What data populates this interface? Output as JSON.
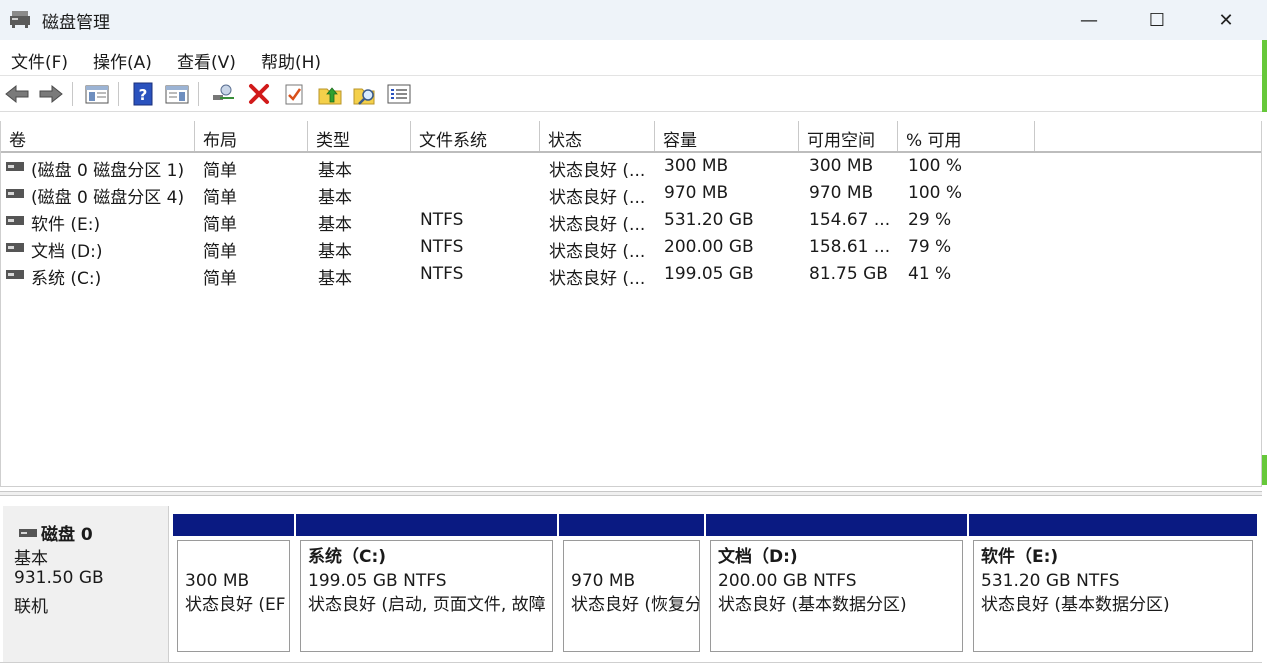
{
  "window": {
    "title": "磁盘管理",
    "minimize_glyph": "—",
    "maximize_glyph": "☐",
    "close_glyph": "✕"
  },
  "menu": [
    {
      "label": "文件(F)"
    },
    {
      "label": "操作(A)"
    },
    {
      "label": "查看(V)"
    },
    {
      "label": "帮助(H)"
    }
  ],
  "toolbar_icons": [
    "back-arrow-icon",
    "forward-arrow-icon",
    "console-tree-icon",
    "help-icon",
    "action-pane-icon",
    "connect-disk-icon",
    "delete-icon",
    "properties-check-icon",
    "up-folder-icon",
    "search-folder-icon",
    "list-view-icon"
  ],
  "columns": [
    "卷",
    "布局",
    "类型",
    "文件系统",
    "状态",
    "容量",
    "可用空间",
    "% 可用"
  ],
  "volumes": [
    {
      "name": "(磁盘 0 磁盘分区 1)",
      "layout": "简单",
      "type": "基本",
      "fs": "",
      "status": "状态良好 (...",
      "capacity": "300 MB",
      "free": "300 MB",
      "pct": "100 %"
    },
    {
      "name": "(磁盘 0 磁盘分区 4)",
      "layout": "简单",
      "type": "基本",
      "fs": "",
      "status": "状态良好 (...",
      "capacity": "970 MB",
      "free": "970 MB",
      "pct": "100 %"
    },
    {
      "name": "软件 (E:)",
      "layout": "简单",
      "type": "基本",
      "fs": "NTFS",
      "status": "状态良好 (...",
      "capacity": "531.20 GB",
      "free": "154.67 ...",
      "pct": "29 %"
    },
    {
      "name": "文档 (D:)",
      "layout": "简单",
      "type": "基本",
      "fs": "NTFS",
      "status": "状态良好 (...",
      "capacity": "200.00 GB",
      "free": "158.61 ...",
      "pct": "79 %"
    },
    {
      "name": "系统 (C:)",
      "layout": "简单",
      "type": "基本",
      "fs": "NTFS",
      "status": "状态良好 (...",
      "capacity": "199.05 GB",
      "free": "81.75 GB",
      "pct": "41 %"
    }
  ],
  "disk": {
    "name": "磁盘 0",
    "kind": "基本",
    "size": "931.50 GB",
    "state": "联机"
  },
  "partitions": [
    {
      "title": "",
      "line1": "300 MB",
      "line2": "状态良好 (EF"
    },
    {
      "title": "系统（C:)",
      "line1": "199.05 GB NTFS",
      "line2": "状态良好 (启动, 页面文件, 故障"
    },
    {
      "title": "",
      "line1": "970 MB",
      "line2": "状态良好 (恢复分"
    },
    {
      "title": "文档（D:)",
      "line1": "200.00 GB NTFS",
      "line2": "状态良好 (基本数据分区)"
    },
    {
      "title": "软件（E:)",
      "line1": "531.20 GB NTFS",
      "line2": "状态良好 (基本数据分区)"
    }
  ],
  "colors": {
    "partition_bar": "#0a1a82",
    "titlebar_bg": "#eef3f9",
    "accent_strip": "#66c83a"
  }
}
